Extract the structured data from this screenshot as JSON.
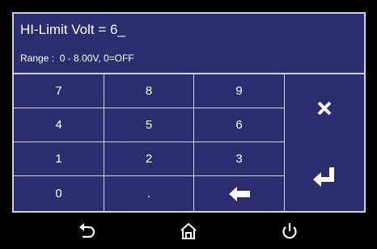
{
  "dialog": {
    "title": "HI-Limit Volt = 6_",
    "range_text": "Range :  0 - 8.00V, 0=OFF"
  },
  "keypad": {
    "keys": [
      "7",
      "8",
      "9",
      "4",
      "5",
      "6",
      "1",
      "2",
      "3",
      "0",
      "."
    ],
    "backspace_icon": "left-arrow-icon",
    "clear_icon": "close-x-icon",
    "enter_icon": "enter-return-icon"
  },
  "nav": {
    "back_icon": "back-arrow-icon",
    "home_icon": "home-icon",
    "power_icon": "power-icon"
  },
  "colors": {
    "panel_bg": "#2b2d6e",
    "border": "#cfd0e8",
    "screen_bg": "#000000"
  }
}
